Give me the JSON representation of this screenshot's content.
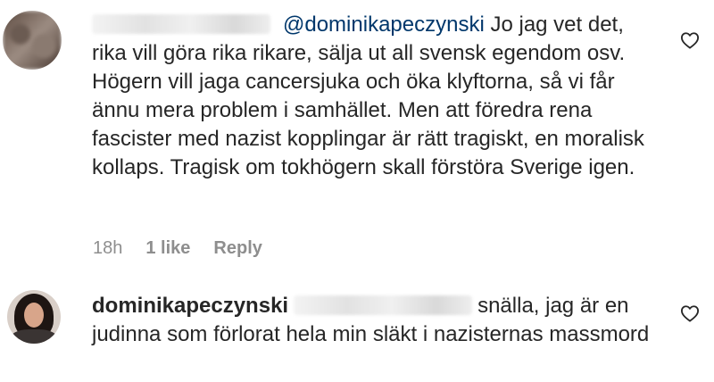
{
  "comments": [
    {
      "mention": "@dominikapeczynski",
      "body": " Jo jag vet det, rika vill göra rika rikare, sälja ut all svensk egendom osv. Högern vill jaga cancersjuka och öka klyftorna, så vi får ännu mera problem i samhället. Men att föredra rena fascister med nazist kopplingar är rätt tragiskt, en moralisk kollaps. Tragisk om tokhögern skall förstöra Sverige igen.",
      "time": "18h",
      "likes": "1 like",
      "reply_label": "Reply"
    },
    {
      "username": "dominikapeczynski",
      "body": "snälla, jag är en judinna som förlorat hela min släkt i nazisternas massmord"
    }
  ],
  "icons": {
    "like": "heart-outline-icon"
  },
  "colors": {
    "text": "#262626",
    "mention": "#00376b",
    "meta": "#8e8e8e"
  }
}
